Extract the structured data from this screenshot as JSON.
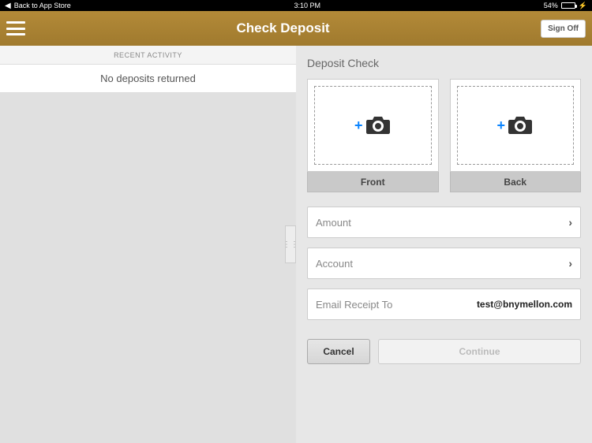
{
  "status": {
    "back": "Back to App Store",
    "time": "3:10 PM",
    "battery_pct": "54%"
  },
  "titlebar": {
    "title": "Check Deposit",
    "signoff": "Sign Off"
  },
  "left": {
    "recent_header": "RECENT ACTIVITY",
    "no_deposits": "No deposits returned"
  },
  "right": {
    "heading": "Deposit Check",
    "front_label": "Front",
    "back_label": "Back",
    "amount_label": "Amount",
    "account_label": "Account",
    "email_label": "Email Receipt To",
    "email_value": "test@bnymellon.com",
    "cancel": "Cancel",
    "continue": "Continue"
  },
  "icons": {
    "plus": "+"
  }
}
